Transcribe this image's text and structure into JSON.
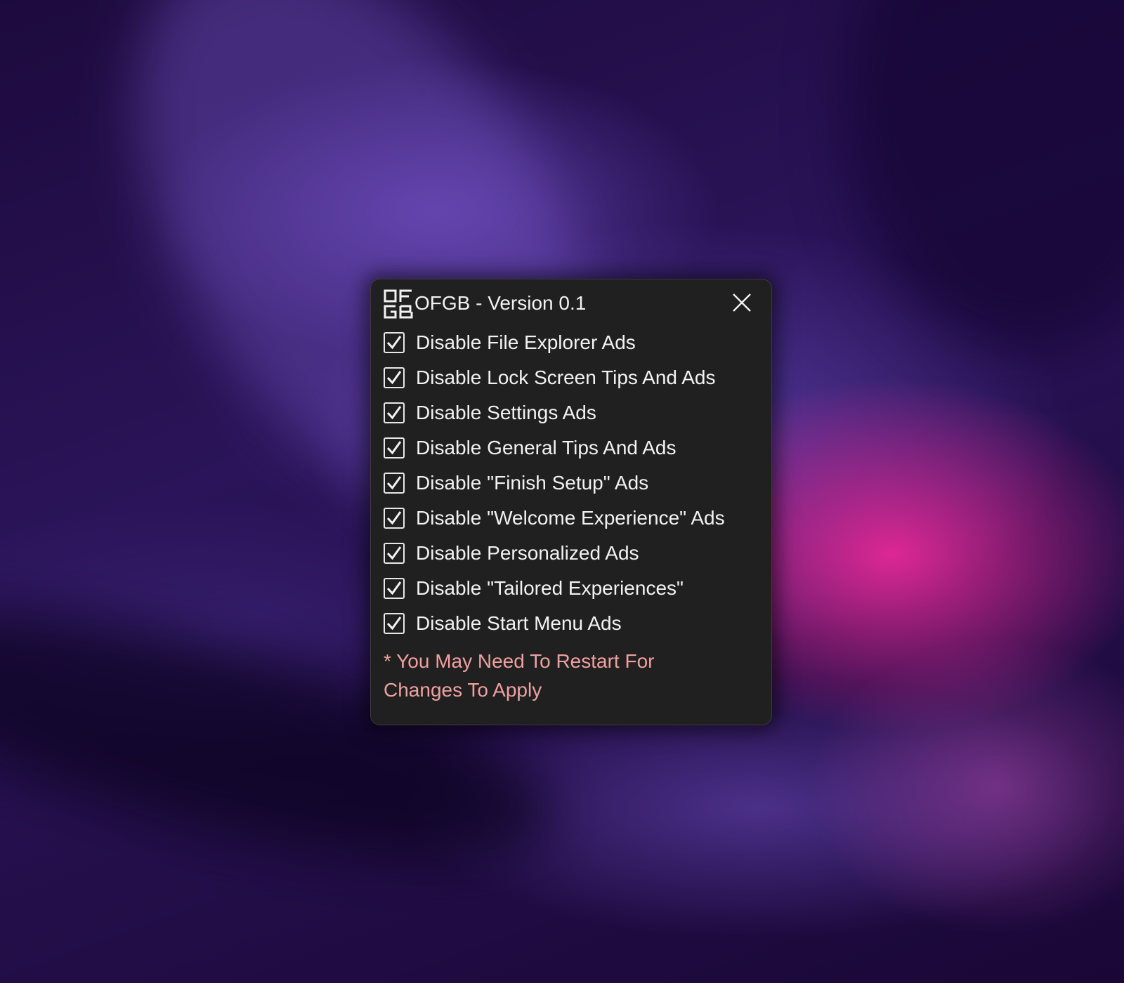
{
  "window": {
    "title": "OFGB - Version 0.1",
    "logo_text": "OFGB",
    "close_icon": "close-icon"
  },
  "options": [
    {
      "label": "Disable File Explorer Ads",
      "checked": true
    },
    {
      "label": "Disable Lock Screen Tips And Ads",
      "checked": true
    },
    {
      "label": "Disable Settings Ads",
      "checked": true
    },
    {
      "label": "Disable General Tips And Ads",
      "checked": true
    },
    {
      "label": "Disable \"Finish Setup\" Ads",
      "checked": true
    },
    {
      "label": "Disable \"Welcome Experience\" Ads",
      "checked": true
    },
    {
      "label": "Disable Personalized Ads",
      "checked": true
    },
    {
      "label": "Disable \"Tailored Experiences\"",
      "checked": true
    },
    {
      "label": "Disable Start Menu Ads",
      "checked": true
    }
  ],
  "notice": "* You May Need To Restart For Changes To Apply",
  "colors": {
    "window_background": "#202020",
    "text": "#f2f2f2",
    "notice_text": "#f0a0a0"
  }
}
